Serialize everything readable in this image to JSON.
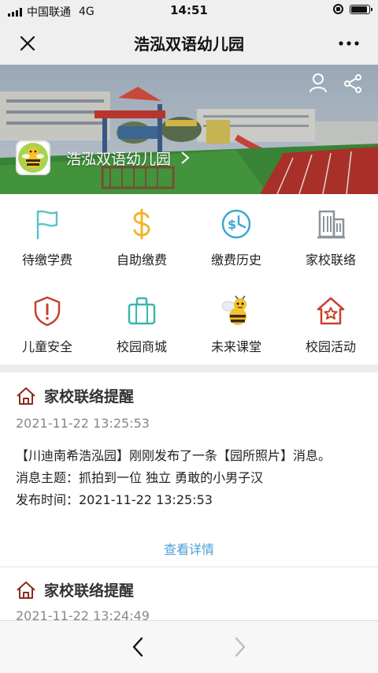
{
  "status_bar": {
    "carrier": "中国联通",
    "network": "4G",
    "time": "14:51"
  },
  "nav": {
    "title": "浩泓双语幼儿园"
  },
  "banner": {
    "school_name": "浩泓双语幼儿园"
  },
  "grid": [
    {
      "label": "待缴学费",
      "icon": "flag-icon",
      "color": "#5cc4c8"
    },
    {
      "label": "自助缴费",
      "icon": "dollar-icon",
      "color": "#f2b430"
    },
    {
      "label": "缴费历史",
      "icon": "history-icon",
      "color": "#38a9d6"
    },
    {
      "label": "家校联络",
      "icon": "building-icon",
      "color": "#8a949c"
    },
    {
      "label": "儿童安全",
      "icon": "shield-icon",
      "color": "#c8412d"
    },
    {
      "label": "校园商城",
      "icon": "bag-icon",
      "color": "#3ab6ad"
    },
    {
      "label": "未来课堂",
      "icon": "bee-icon",
      "color": "#f2b430"
    },
    {
      "label": "校园活动",
      "icon": "house-star-icon",
      "color": "#c8412d"
    }
  ],
  "messages": [
    {
      "title": "家校联络提醒",
      "time": "2021-11-22 13:25:53",
      "line1": "【川迪南希浩泓园】刚刚发布了一条【园所照片】消息。",
      "line2": "消息主题：抓拍到一位 独立 勇敢的小男子汉",
      "line3": "发布时间：2021-11-22 13:25:53",
      "link": "查看详情"
    },
    {
      "title": "家校联络提醒",
      "time": "2021-11-22 13:24:49"
    }
  ]
}
